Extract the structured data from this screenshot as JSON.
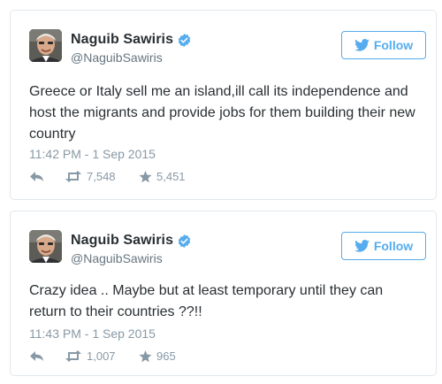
{
  "colors": {
    "accent": "#55acee",
    "verified": "#55acee",
    "text": "#292f33",
    "muted": "#8899a6",
    "border": "#e1e8ed"
  },
  "icons": {
    "verified": "verified-badge-icon",
    "bird": "twitter-bird-icon",
    "reply": "reply-arrow-icon",
    "retweet": "retweet-icon",
    "favorite": "star-icon"
  },
  "tweets": [
    {
      "display_name": "Naguib Sawiris",
      "handle": "@NaguibSawiris",
      "follow_label": "Follow",
      "text": "Greece or Italy sell me an island,ill call its independence and host the migrants and provide jobs for them building their new country",
      "timestamp": "11:42 PM - 1 Sep 2015",
      "retweets": "7,548",
      "favorites": "5,451"
    },
    {
      "display_name": "Naguib Sawiris",
      "handle": "@NaguibSawiris",
      "follow_label": "Follow",
      "text": "Crazy idea .. Maybe but at least temporary until they can return to their countries ??!!",
      "timestamp": "11:43 PM - 1 Sep 2015",
      "retweets": "1,007",
      "favorites": "965"
    }
  ]
}
